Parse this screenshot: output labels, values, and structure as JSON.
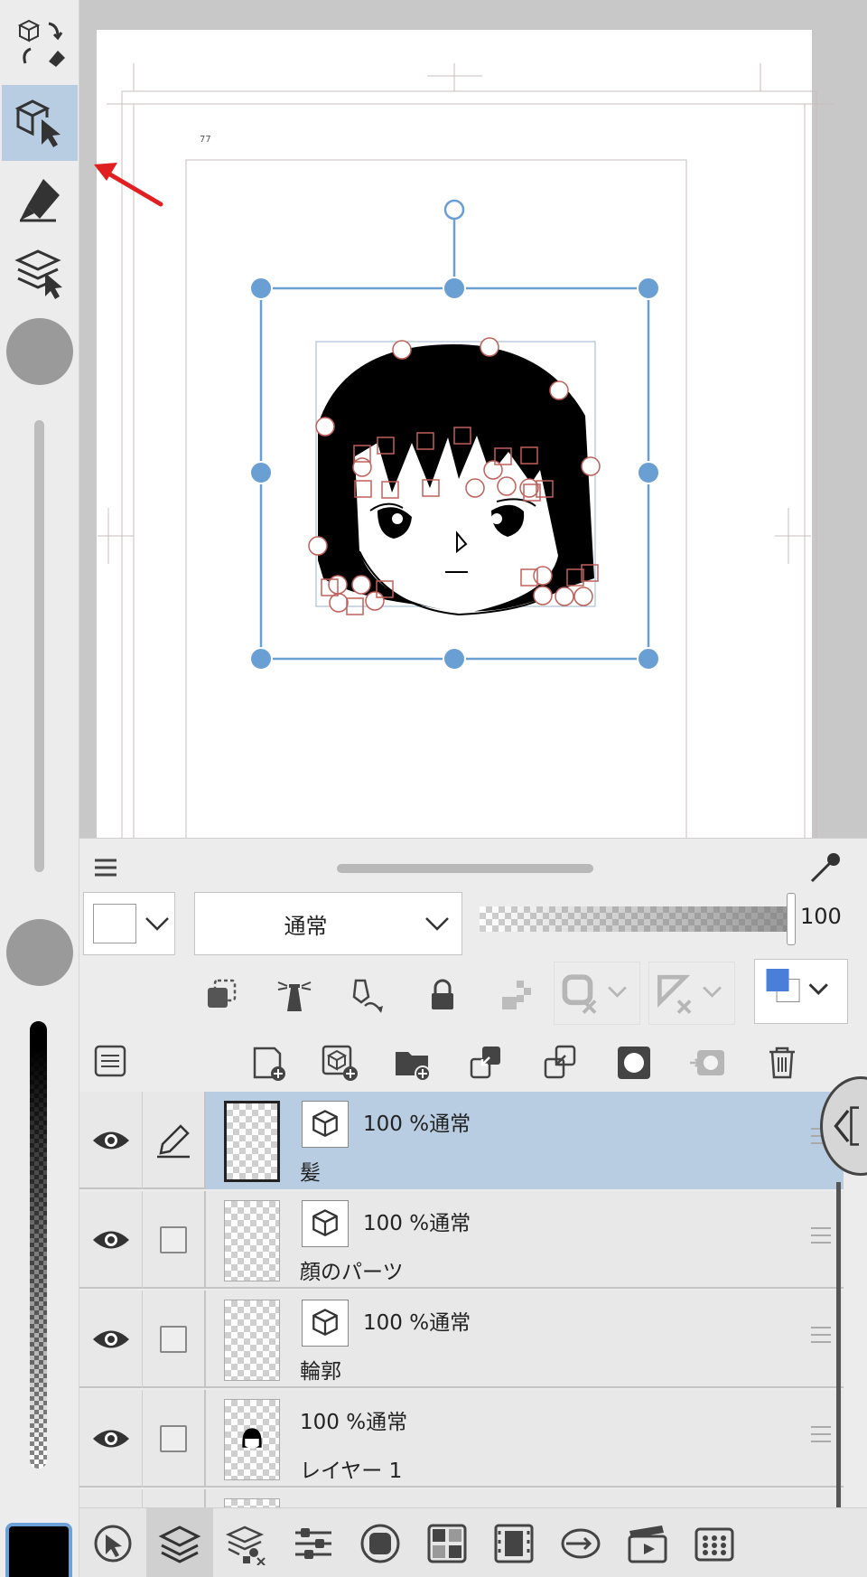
{
  "canvas": {
    "zoom_indicator": "77"
  },
  "layer_panel": {
    "blend_mode": "通常",
    "opacity": "100",
    "layers": [
      {
        "name": "髪",
        "blend": "100 %通常",
        "selected": true,
        "type": "3d"
      },
      {
        "name": "顔のパーツ",
        "blend": "100 %通常",
        "selected": false,
        "type": "3d"
      },
      {
        "name": "輪郭",
        "blend": "100 %通常",
        "selected": false,
        "type": "3d"
      },
      {
        "name": "レイヤー 1",
        "blend": "100 %通常",
        "selected": false,
        "type": "raster"
      }
    ]
  },
  "colors": {
    "accent": "#6a9fd4",
    "selected_row": "#b9cde2",
    "arrow": "#e02020",
    "control_point": "#c0605a"
  },
  "icons": {
    "left_toolbar": [
      "undo-redo-icon",
      "object-select-icon",
      "pen-icon",
      "layer-select-icon"
    ],
    "bottom_tabs": [
      "tool-icon",
      "layer-icon",
      "layer-property-icon",
      "tool-property-icon",
      "sub-tool-icon",
      "color-icon",
      "animation-icon",
      "navigator-icon",
      "timeline-icon",
      "menu-icon"
    ]
  }
}
